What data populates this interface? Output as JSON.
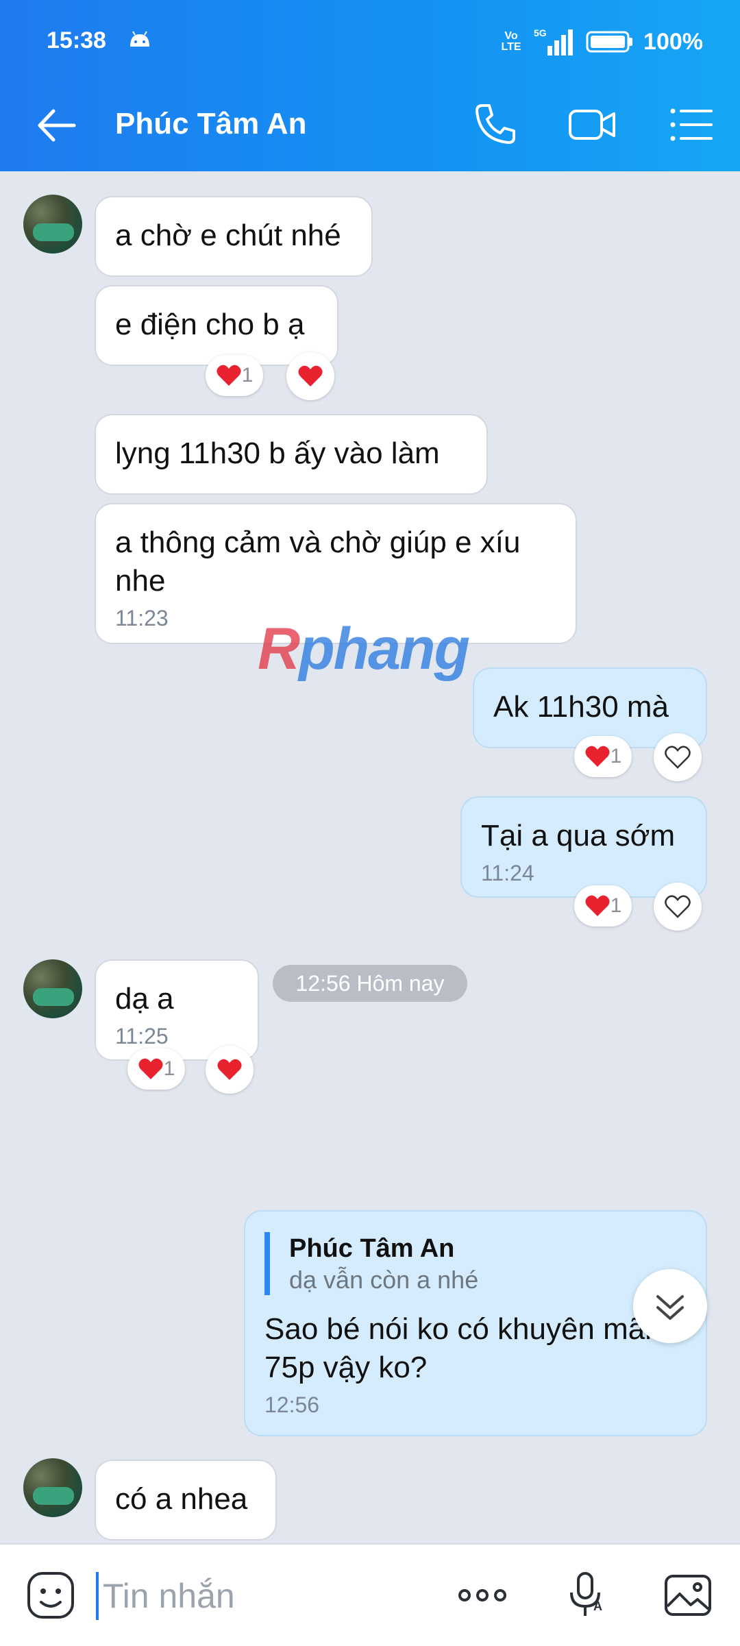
{
  "status": {
    "time": "15:38",
    "volte": "Vo LTE",
    "network": "5G",
    "battery": "100%"
  },
  "header": {
    "contact_name": "Phúc Tâm An"
  },
  "messages": [
    {
      "text": "a chờ e chút nhé"
    },
    {
      "text": "e điện cho b ạ",
      "reaction_count": "1"
    },
    {
      "text": "lyng 11h30 b ấy vào làm"
    },
    {
      "text": "a thông cảm và chờ giúp e xíu nhe",
      "time": "11:23"
    },
    {
      "text": "Ak 11h30 mà",
      "reaction_count": "1"
    },
    {
      "text": "Tại a qua sớm",
      "time": "11:24",
      "reaction_count": "1"
    },
    {
      "text": "dạ a",
      "time": "11:25",
      "reaction_count": "1"
    },
    {
      "quote_name": "Phúc Tâm An",
      "quote_text": "dạ vẫn còn a nhé",
      "text": "Sao bé nói ko có khuyên mãi 75p vậy ko?",
      "time": "12:56"
    },
    {
      "text": "có a nhea"
    }
  ],
  "date_separator": "12:56 Hôm nay",
  "watermark": {
    "part1": "R",
    "part2": "phang"
  },
  "input": {
    "placeholder": "Tin nhắn"
  }
}
